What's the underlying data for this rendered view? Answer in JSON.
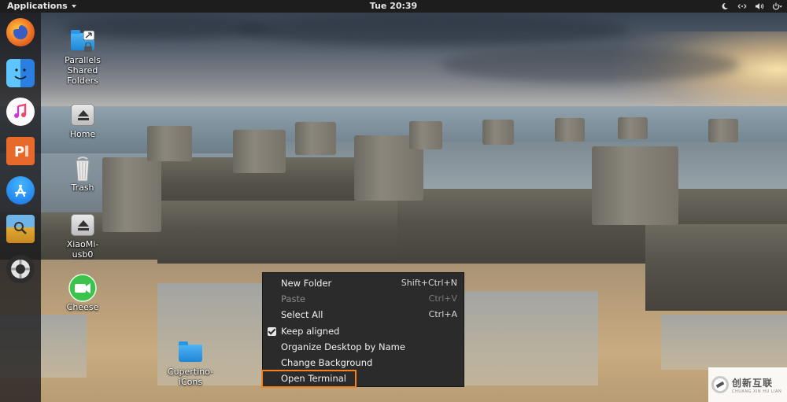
{
  "topbar": {
    "applications_label": "Applications",
    "clock": "Tue 20:39",
    "tray_icons": [
      "night-light-icon",
      "network-icon",
      "volume-icon",
      "power-icon"
    ]
  },
  "dock": {
    "items": [
      {
        "name": "firefox",
        "icon": "firefox-icon",
        "color": "#e8572c"
      },
      {
        "name": "finder",
        "icon": "finder-icon",
        "color": "#2f8fe8"
      },
      {
        "name": "itunes",
        "icon": "music-icon",
        "color": "#f24d6f"
      },
      {
        "name": "presentation",
        "icon": "presentation-icon",
        "color": "#e8692a"
      },
      {
        "name": "app-store",
        "icon": "app-store-icon",
        "color": "#1e8ff0"
      },
      {
        "name": "preview",
        "icon": "preview-icon",
        "color": "#d9a431"
      },
      {
        "name": "help",
        "icon": "lifebuoy-icon",
        "color": "#cfcfcf"
      }
    ]
  },
  "desktop": {
    "icons": [
      {
        "id": "parallels",
        "label": "Parallels\nShared\nFolders",
        "icon": "shared-folder-icon"
      },
      {
        "id": "home",
        "label": "Home",
        "icon": "drive-icon"
      },
      {
        "id": "trash",
        "label": "Trash",
        "icon": "trash-icon"
      },
      {
        "id": "xiaomi",
        "label": "XiaoMi-\nusb0",
        "icon": "drive-icon"
      },
      {
        "id": "cheese",
        "label": "Cheese",
        "icon": "camera-icon"
      },
      {
        "id": "cupertino",
        "label": "Cupertino-\niCons",
        "icon": "folder-icon"
      }
    ]
  },
  "context_menu": {
    "items": [
      {
        "label": "New Folder",
        "shortcut": "Shift+Ctrl+N",
        "disabled": false,
        "checked": false
      },
      {
        "label": "Paste",
        "shortcut": "Ctrl+V",
        "disabled": true,
        "checked": false
      },
      {
        "label": "Select All",
        "shortcut": "Ctrl+A",
        "disabled": false,
        "checked": false
      },
      {
        "label": "Keep aligned",
        "shortcut": "",
        "disabled": false,
        "checked": true
      },
      {
        "label": "Organize Desktop by Name",
        "shortcut": "",
        "disabled": false,
        "checked": false
      },
      {
        "label": "Change Background",
        "shortcut": "",
        "disabled": false,
        "checked": false
      },
      {
        "label": "Open Terminal",
        "shortcut": "",
        "disabled": false,
        "checked": false,
        "highlighted": true
      }
    ],
    "highlight_color": "#f5811f"
  },
  "watermark": {
    "text": "创新互联",
    "subtext": "CHUANG XIN HU LIAN"
  }
}
